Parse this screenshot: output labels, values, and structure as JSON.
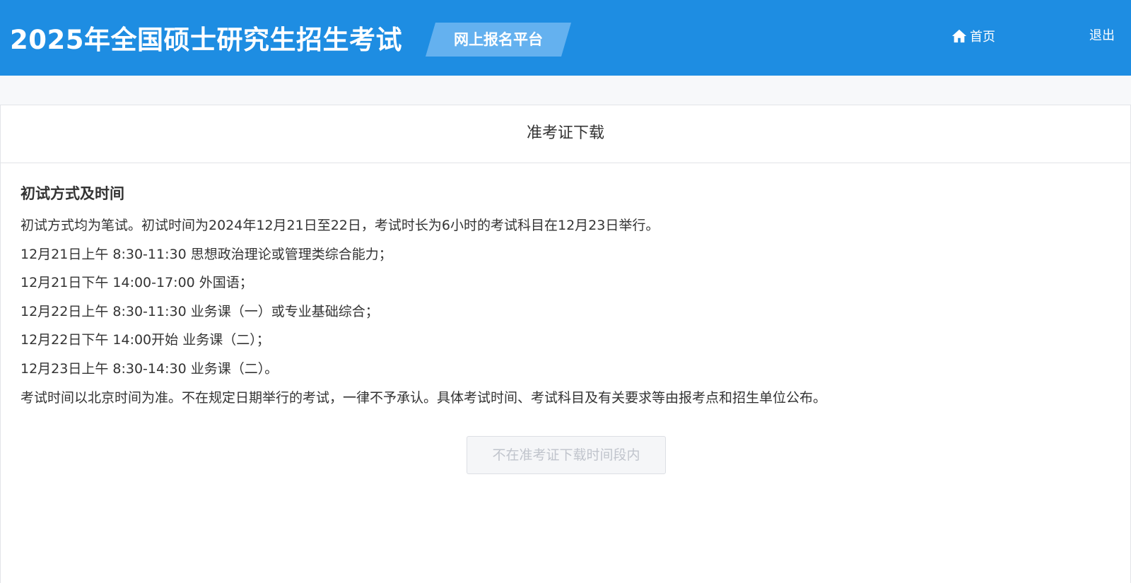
{
  "header": {
    "site_title": "2025年全国硕士研究生招生考试",
    "platform_label": "网上报名平台",
    "nav_home_label": "首页",
    "nav_logout_label": "退出"
  },
  "panel": {
    "title": "准考证下载",
    "section_title": "初试方式及时间",
    "lines": [
      "初试方式均为笔试。初试时间为2024年12月21日至22日，考试时长为6小时的考试科目在12月23日举行。",
      "12月21日上午 8:30-11:30 思想政治理论或管理类综合能力；",
      "12月21日下午 14:00-17:00 外国语；",
      "12月22日上午 8:30-11:30 业务课（一）或专业基础综合；",
      "12月22日下午 14:00开始 业务课（二）；",
      "12月23日上午 8:30-14:30 业务课（二）。",
      "考试时间以北京时间为准。不在规定日期举行的考试，一律不予承认。具体考试时间、考试科目及有关要求等由报考点和招生单位公布。"
    ],
    "download_button_label": "不在准考证下载时间段内"
  },
  "colors": {
    "header_bg": "#1e8de2",
    "badge_bg": "#64b1ef",
    "disabled_text": "#c0c4cc"
  },
  "icons": {
    "home": "home-icon"
  }
}
